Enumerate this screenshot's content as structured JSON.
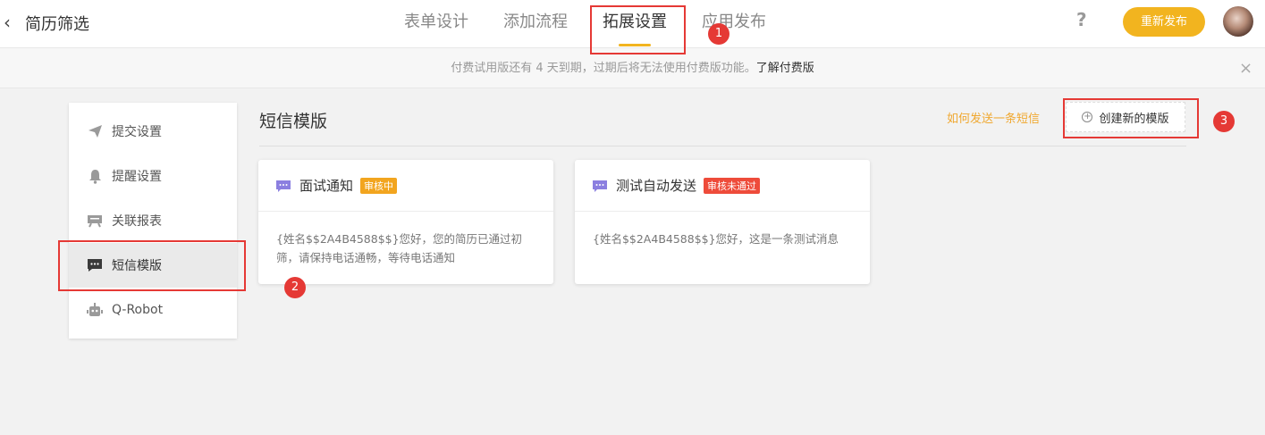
{
  "header": {
    "app_title": "简历筛选",
    "tabs": [
      {
        "label": "表单设计"
      },
      {
        "label": "添加流程"
      },
      {
        "label": "拓展设置"
      },
      {
        "label": "应用发布"
      }
    ],
    "help_label": "?",
    "republish_label": "重新发布",
    "back_icon": "‹"
  },
  "banner": {
    "text": "付费试用版还有 4 天到期，过期后将无法使用付费版功能。",
    "link": "了解付费版",
    "close": "×"
  },
  "sidebar": {
    "items": [
      {
        "label": "提交设置",
        "icon": "paper-plane-icon"
      },
      {
        "label": "提醒设置",
        "icon": "bell-icon"
      },
      {
        "label": "关联报表",
        "icon": "report-icon"
      },
      {
        "label": "短信模版",
        "icon": "sms-icon"
      },
      {
        "label": "Q-Robot",
        "icon": "robot-icon"
      }
    ]
  },
  "main": {
    "title": "短信模版",
    "howto_link": "如何发送一条短信",
    "create_label": "创建新的模版",
    "cards": [
      {
        "name": "面试通知",
        "status": "审核中",
        "content": "{姓名$$2A4B4588$$}您好，您的简历已通过初筛，请保持电话通畅，等待电话通知"
      },
      {
        "name": "测试自动发送",
        "status": "审核未通过",
        "content": "{姓名$$2A4B4588$$}您好，这是一条测试消息"
      }
    ]
  },
  "annotations": {
    "markers": [
      "1",
      "2",
      "3"
    ]
  },
  "colors": {
    "accent": "#f2b41f",
    "annotation": "#e53935",
    "badge_pending": "#f2a51f",
    "badge_rejected": "#ee4b3a",
    "sms_icon": "#8b7fe0"
  }
}
